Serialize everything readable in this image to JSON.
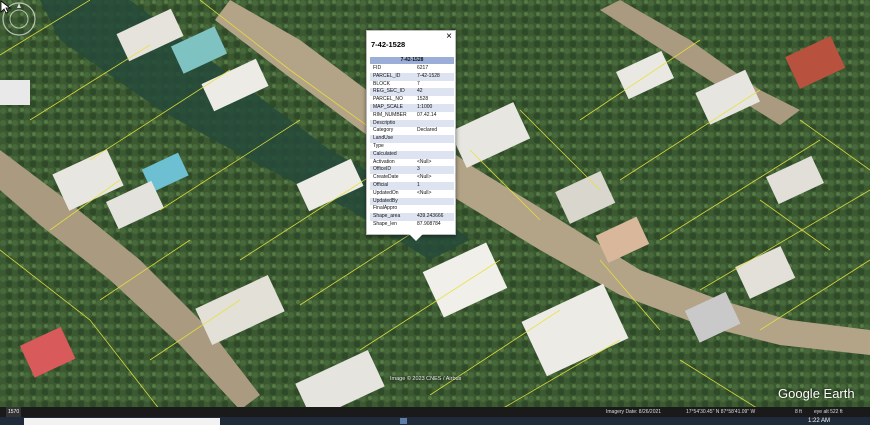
{
  "popup": {
    "title": "7-42-1528",
    "close": "×",
    "header": "7-42-1528",
    "rows": [
      {
        "k": "FID",
        "v": "6217"
      },
      {
        "k": "PARCEL_ID",
        "v": "7-42-1528"
      },
      {
        "k": "BLOCK",
        "v": "7"
      },
      {
        "k": "REG_SEC_ID",
        "v": "42"
      },
      {
        "k": "PARCEL_NO",
        "v": "1528"
      },
      {
        "k": "MAP_SCALE",
        "v": "1:1000"
      },
      {
        "k": "RIM_NUMBER",
        "v": "07.42.14"
      },
      {
        "k": "Descriptio",
        "v": ""
      },
      {
        "k": "Category",
        "v": "Declared"
      },
      {
        "k": "LandUse",
        "v": ""
      },
      {
        "k": "Type",
        "v": ""
      },
      {
        "k": "Calculated",
        "v": ""
      },
      {
        "k": "Activation",
        "v": "<Null>"
      },
      {
        "k": "OfficeID",
        "v": "3"
      },
      {
        "k": "CreateDate",
        "v": "<Null>"
      },
      {
        "k": "Official",
        "v": "1"
      },
      {
        "k": "UpdatedOn",
        "v": "<Null>"
      },
      {
        "k": "UpdatedBy",
        "v": ""
      },
      {
        "k": "FinalAppro",
        "v": ""
      },
      {
        "k": "Shape_area",
        "v": "439.243666"
      },
      {
        "k": "Shape_len",
        "v": "87.908784"
      }
    ]
  },
  "map": {
    "credit": "Image © 2023 CNES / Airbus",
    "logo": "Google Earth"
  },
  "status": {
    "scale": "1570",
    "imagery_date": "Imagery Date: 8/26/2021",
    "coords": "17°54'30.45\" N   87°58'41.09\" W",
    "elev": "8 ft",
    "eye_alt": "eye alt  522 ft"
  },
  "taskbar": {
    "clock": "1:22 AM"
  },
  "colors": {
    "parcel_line": "#e8e23a",
    "popup_header": "#9aaed8",
    "road": "#b7a78a",
    "vegetation": "#3e5f33"
  }
}
